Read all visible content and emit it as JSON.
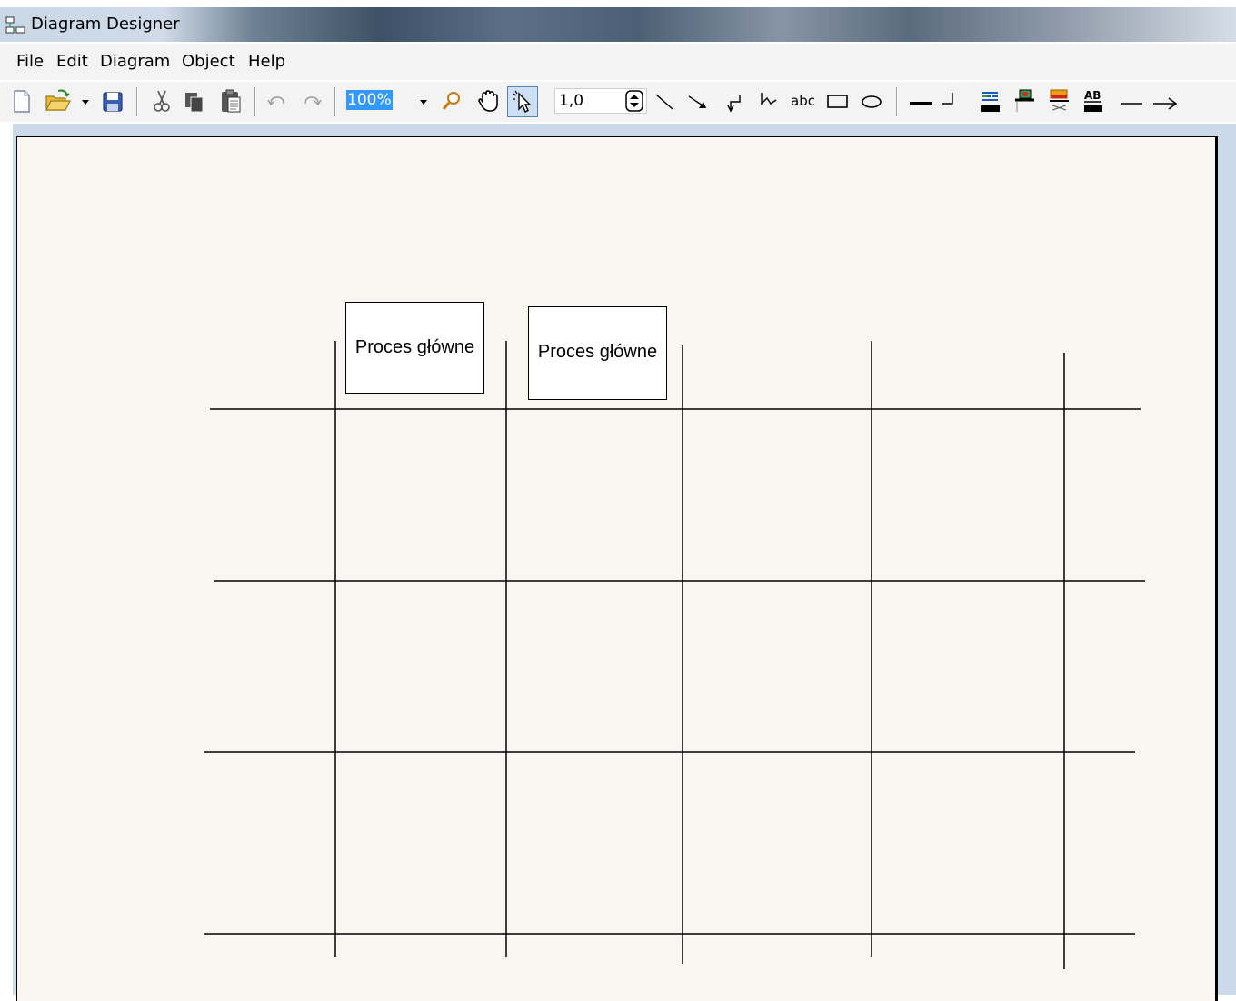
{
  "window": {
    "title": "Diagram Designer"
  },
  "menu": {
    "items": [
      "File",
      "Edit",
      "Diagram",
      "Object",
      "Help"
    ]
  },
  "toolbar": {
    "zoom_value": "100%",
    "line_width_value": "1,0",
    "text_tool_label": "abc",
    "buttons": [
      "new-icon",
      "open-icon",
      "open-dropdown-icon",
      "save-icon",
      "cut-icon",
      "copy-icon",
      "paste-icon",
      "undo-icon",
      "redo-icon",
      "zoom-icon",
      "pan-hand-icon",
      "select-pointer-icon",
      "line-tool-icon",
      "arrow-tool-icon",
      "elbow-connector-icon",
      "curve-connector-icon",
      "text-tool-icon",
      "rectangle-tool-icon",
      "ellipse-tool-icon",
      "line-style-icon",
      "line-corner-icon",
      "fill-color-icon",
      "line-color-icon",
      "shadow-color-icon",
      "text-color-icon",
      "plain-line-end-icon",
      "arrow-line-end-icon"
    ]
  },
  "diagram": {
    "shapes": [
      {
        "type": "process",
        "label": "Proces główne"
      },
      {
        "type": "process",
        "label": "Proces główne"
      }
    ],
    "grid": {
      "horizontal_lines": 4,
      "vertical_lines": 5
    }
  },
  "colors": {
    "page_background": "#f9f6f1",
    "workspace_background": "#ccd9ea",
    "selection_highlight": "#3399ff",
    "stroke": "#000000"
  }
}
